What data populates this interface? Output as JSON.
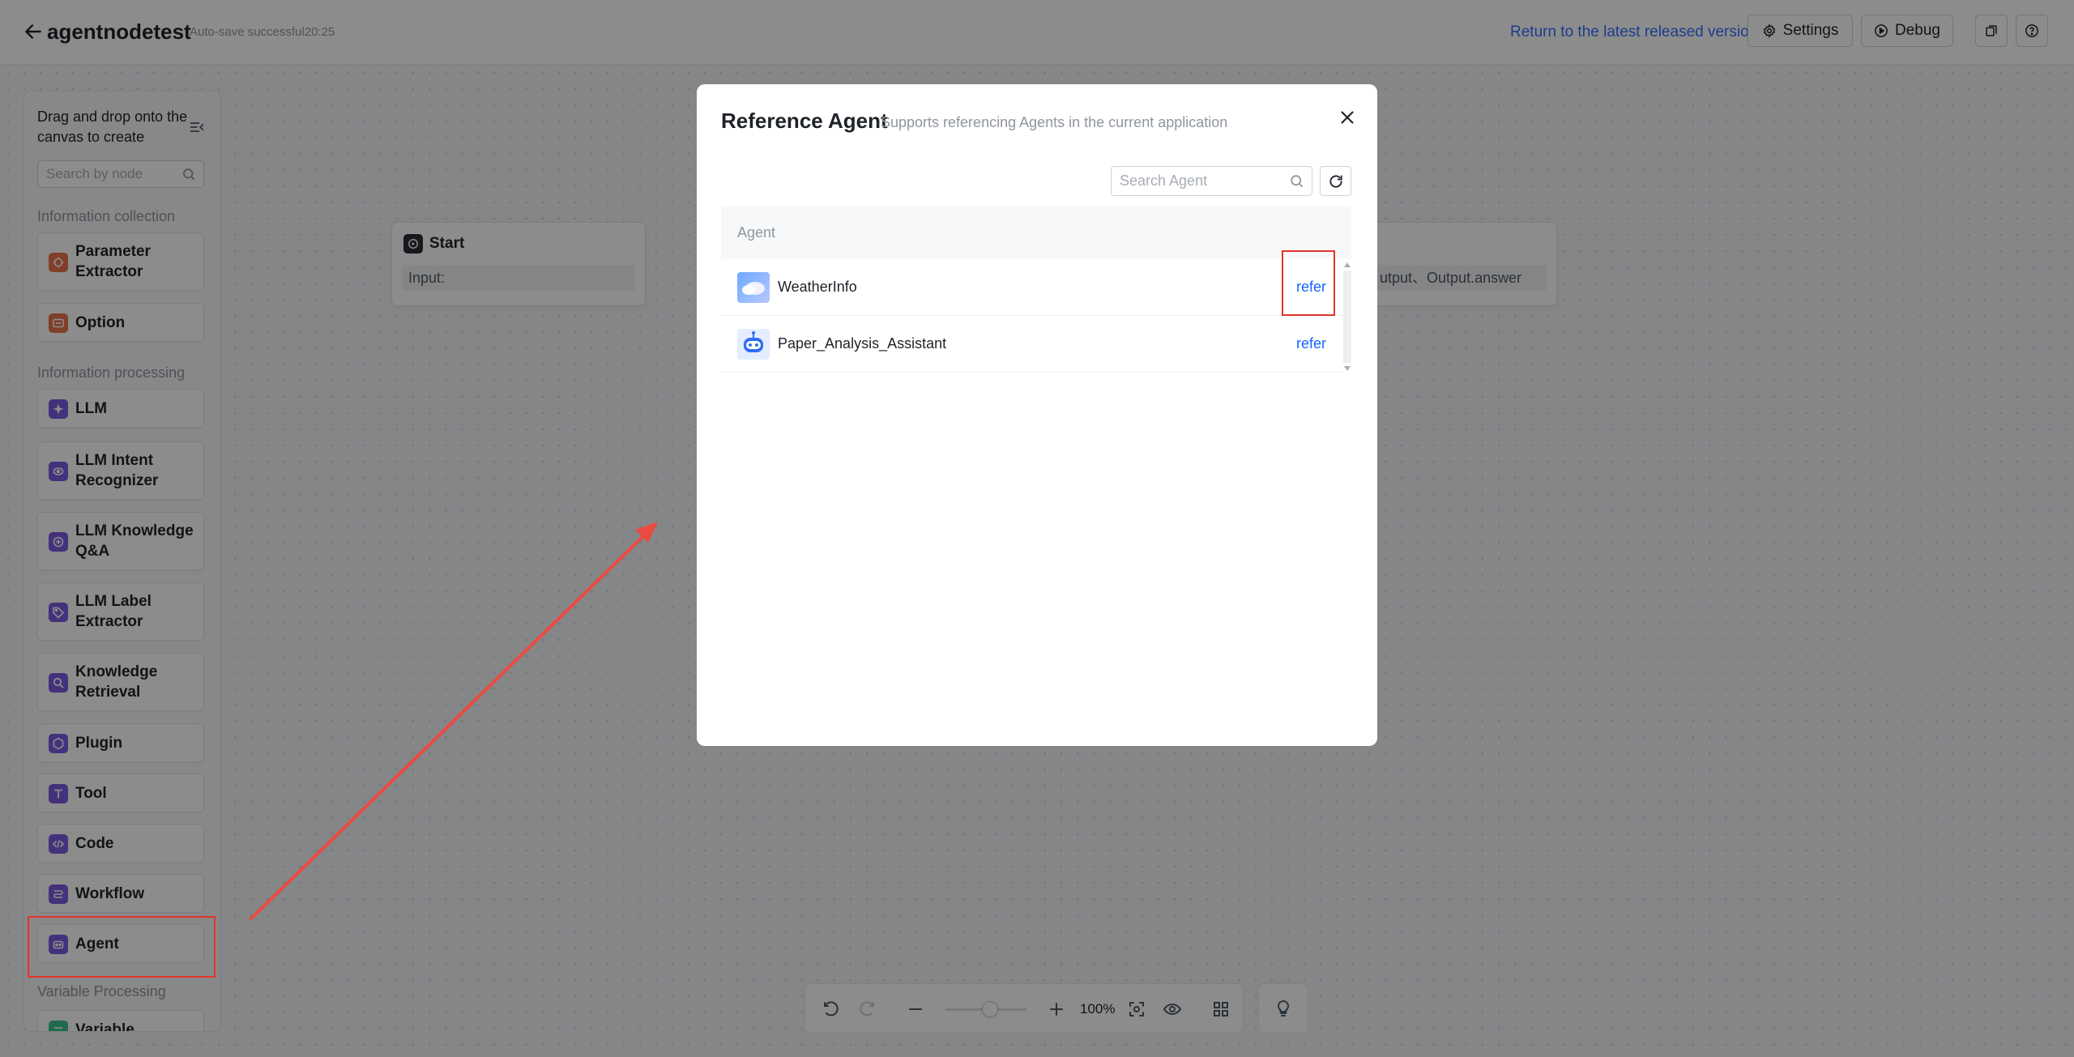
{
  "header": {
    "title": "agentnodetest",
    "autosave": "Auto-save successful20:25",
    "return_link": "Return to the latest released version.",
    "settings_label": "Settings",
    "debug_label": "Debug"
  },
  "panel": {
    "hint": "Drag and drop onto the canvas to create",
    "search_placeholder": "Search by node",
    "categories": [
      "Information collection",
      "Information processing",
      "Variable Processing"
    ],
    "nodes": [
      {
        "label": "Parameter Extractor",
        "icon": "parameter-extractor-icon",
        "color": "#e8734a"
      },
      {
        "label": "Option",
        "icon": "option-icon",
        "color": "#e8734a"
      },
      {
        "label": "LLM",
        "icon": "sparkle-icon",
        "color": "#7b5be0"
      },
      {
        "label": "LLM Intent Recognizer",
        "icon": "intent-icon",
        "color": "#7b5be0"
      },
      {
        "label": "LLM Knowledge Q&A",
        "icon": "knowledge-qa-icon",
        "color": "#7b5be0"
      },
      {
        "label": "LLM Label Extractor",
        "icon": "label-icon",
        "color": "#7b5be0"
      },
      {
        "label": "Knowledge Retrieval",
        "icon": "retrieval-icon",
        "color": "#7b5be0"
      },
      {
        "label": "Plugin",
        "icon": "plugin-icon",
        "color": "#7b5be0"
      },
      {
        "label": "Tool",
        "icon": "tool-icon",
        "color": "#7b5be0"
      },
      {
        "label": "Code",
        "icon": "code-icon",
        "color": "#7b5be0"
      },
      {
        "label": "Workflow",
        "icon": "workflow-icon",
        "color": "#7b5be0"
      },
      {
        "label": "Agent",
        "icon": "agent-icon",
        "color": "#7b5be0"
      },
      {
        "label": "Variable",
        "icon": "variable-icon",
        "color": "#3ec28f"
      }
    ]
  },
  "canvas": {
    "start_node": {
      "title": "Start",
      "field": "Input:"
    },
    "end_node": {
      "field": "utput、Output.answer"
    }
  },
  "toolbar": {
    "zoom": "100%",
    "zoom_level": 0.55
  },
  "modal": {
    "title": "Reference Agent",
    "subtitle": "Supports referencing Agents in the current application",
    "search_placeholder": "Search Agent",
    "column_header": "Agent",
    "rows": [
      {
        "name": "WeatherInfo",
        "action": "refer",
        "avatar": "cloud-avatar-icon"
      },
      {
        "name": "Paper_Analysis_Assistant",
        "action": "refer",
        "avatar": "robot-avatar-icon"
      }
    ]
  },
  "colors": {
    "accent": "#1664ff",
    "highlight": "#e5332a",
    "node_orange": "#e8734a",
    "node_purple": "#7b5be0"
  }
}
